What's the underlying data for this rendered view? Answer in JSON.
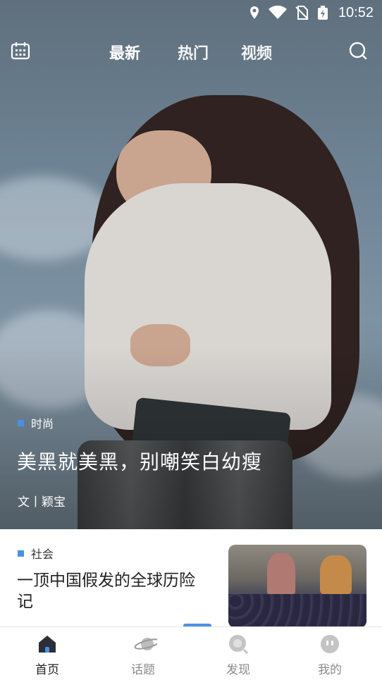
{
  "status_bar": {
    "time": "10:52"
  },
  "top_nav": {
    "tabs": [
      {
        "label": "最新",
        "active": true
      },
      {
        "label": "热门",
        "active": false
      },
      {
        "label": "视频",
        "active": false
      }
    ],
    "left_icon": "calendar-icon",
    "right_icon": "search-icon"
  },
  "hero": {
    "category": "时尚",
    "title": "美黑就美黑，别嘲笑白幼瘦",
    "author": "文丨颖宝"
  },
  "feed": {
    "items": [
      {
        "category": "社会",
        "title": "一顶中国假发的全球历险记"
      }
    ]
  },
  "bottom_nav": {
    "items": [
      {
        "label": "首页",
        "icon": "home-icon",
        "active": true
      },
      {
        "label": "话题",
        "icon": "planet-icon",
        "active": false
      },
      {
        "label": "发现",
        "icon": "discover-icon",
        "active": false
      },
      {
        "label": "我的",
        "icon": "profile-icon",
        "active": false
      }
    ]
  },
  "colors": {
    "accent": "#4a90e2",
    "nav_inactive": "#8a8a8a"
  }
}
